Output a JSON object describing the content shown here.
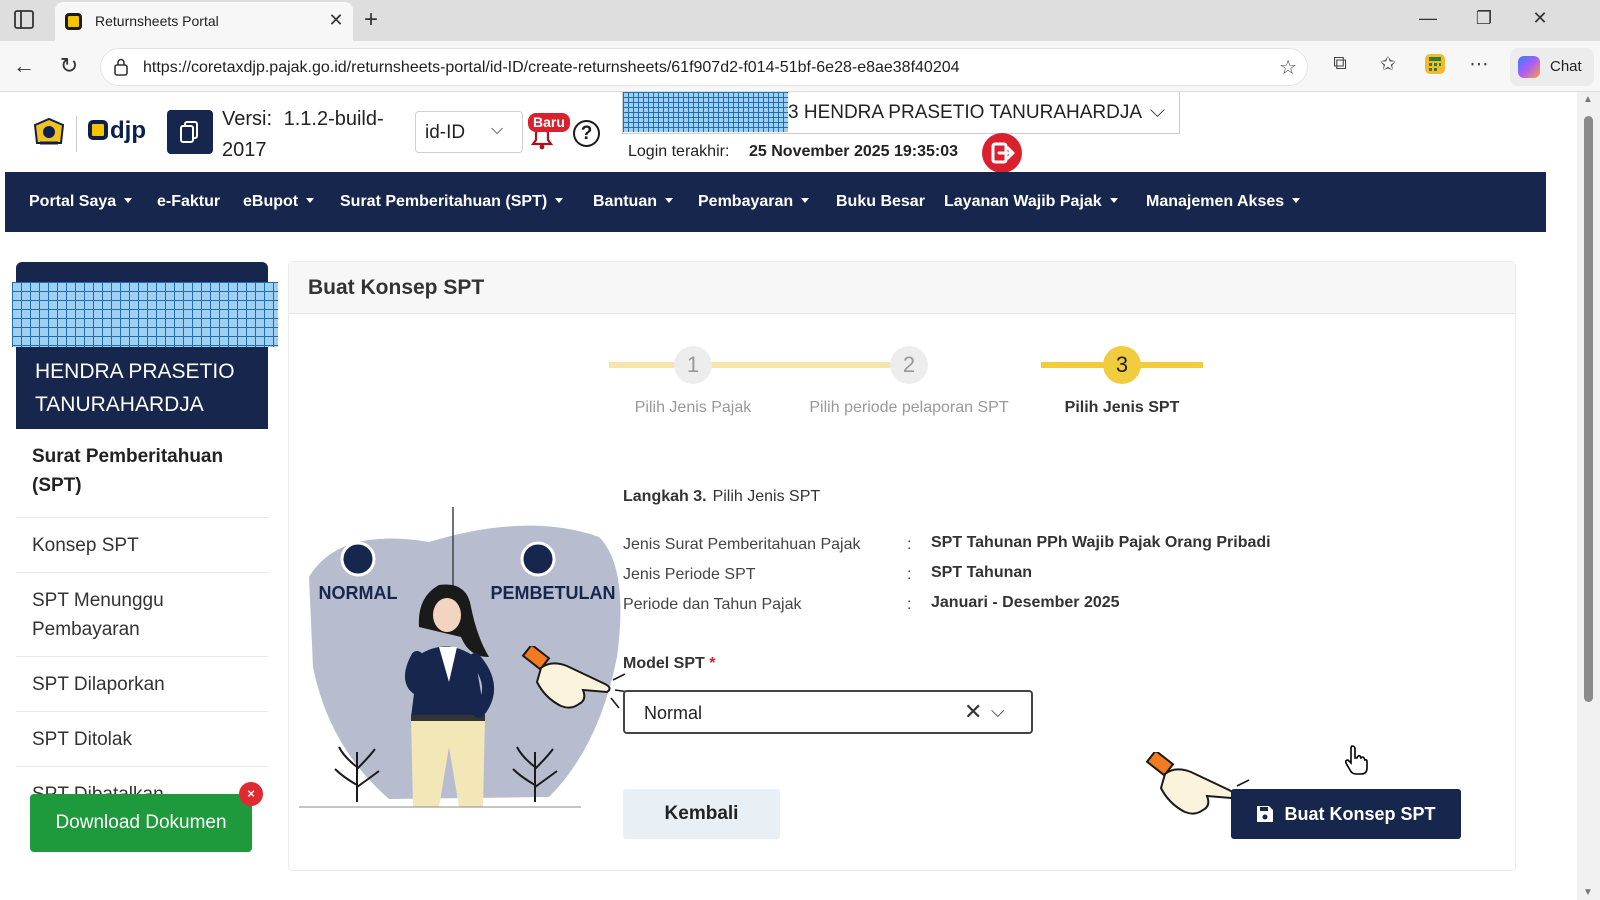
{
  "browser": {
    "tab_title": "Returnsheets Portal",
    "url": "https://coretaxdjp.pajak.go.id/returnsheets-portal/id-ID/create-returnsheets/61f907d2-f014-51bf-6e28-e8ae38f40204",
    "chat_label": "Chat"
  },
  "header": {
    "logo_text": "djp",
    "version_label": "Versi:",
    "version_value": "1.1.2-build-2017",
    "language": "id-ID",
    "notification_badge": "Baru",
    "help_glyph": "?",
    "taxpayer_name": "3 HENDRA PRASETIO TANURAHARDJA",
    "last_login_label": "Login terakhir:",
    "last_login_value": "25 November 2025 19:35:03"
  },
  "nav": {
    "items": [
      {
        "label": "Portal Saya",
        "dropdown": true
      },
      {
        "label": "e-Faktur",
        "dropdown": false
      },
      {
        "label": "eBupot",
        "dropdown": true
      },
      {
        "label": "Surat Pemberitahuan (SPT)",
        "dropdown": true
      },
      {
        "label": "Bantuan",
        "dropdown": true
      },
      {
        "label": "Pembayaran",
        "dropdown": true
      },
      {
        "label": "Buku Besar",
        "dropdown": false
      },
      {
        "label": "Layanan Wajib Pajak",
        "dropdown": true
      },
      {
        "label": "Manajemen Akses",
        "dropdown": true
      }
    ]
  },
  "sidebar": {
    "user_name": "HENDRA PRASETIO TANURAHARDJA",
    "section_title": "Surat Pemberitahuan (SPT)",
    "items": [
      {
        "label": "Konsep SPT"
      },
      {
        "label": "SPT Menunggu Pembayaran"
      },
      {
        "label": "SPT Dilaporkan"
      },
      {
        "label": "SPT Ditolak"
      },
      {
        "label": "SPT Dibatalkan"
      }
    ],
    "download_button": "Download Dokumen",
    "download_close": "×"
  },
  "main": {
    "title": "Buat Konsep SPT",
    "steps": [
      {
        "number": "1",
        "label": "Pilih Jenis Pajak",
        "active": false
      },
      {
        "number": "2",
        "label": "Pilih periode pelaporan SPT",
        "active": false
      },
      {
        "number": "3",
        "label": "Pilih Jenis SPT",
        "active": true
      }
    ],
    "illustration": {
      "label_left": "NORMAL",
      "label_right": "PEMBETULAN"
    },
    "step_heading_bold": "Langkah 3.",
    "step_heading_text": "Pilih Jenis SPT",
    "info": [
      {
        "key": "Jenis Surat Pemberitahuan Pajak",
        "colon": ":",
        "value": "SPT Tahunan PPh Wajib Pajak Orang Pribadi"
      },
      {
        "key": "Jenis Periode SPT",
        "colon": ":",
        "value": "SPT Tahunan"
      },
      {
        "key": "Periode dan Tahun Pajak",
        "colon": ":",
        "value": "Januari - Desember 2025"
      }
    ],
    "model_label": "Model SPT",
    "model_required": "*",
    "model_value": "Normal",
    "back_button": "Kembali",
    "create_button": "Buat Konsep SPT"
  },
  "colors": {
    "navy": "#16264d",
    "accent_yellow": "#f2cc3f",
    "download_green": "#1e9a3d",
    "danger_red": "#d9202c"
  }
}
